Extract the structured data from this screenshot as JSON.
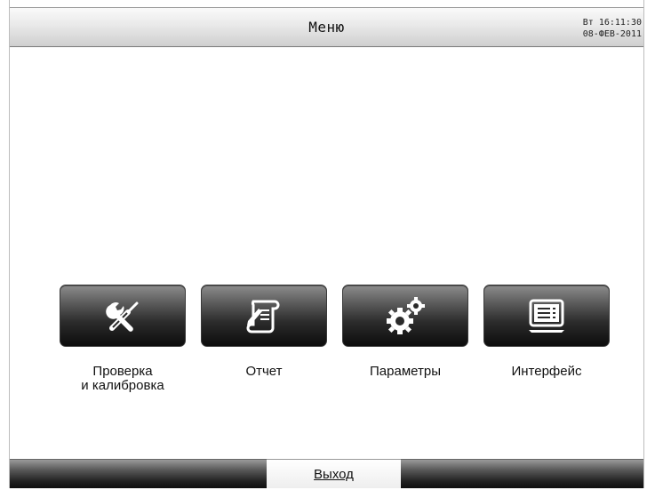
{
  "header": {
    "title": "Меню",
    "clock_time": "Вт 16:11:30",
    "clock_date": "08-ФЕВ-2011"
  },
  "menu": {
    "items": [
      {
        "label": "Проверка\nи калибровка",
        "icon": "tools-icon"
      },
      {
        "label": "Отчет",
        "icon": "report-scroll-icon"
      },
      {
        "label": "Параметры",
        "icon": "gears-icon"
      },
      {
        "label": "Интерфейс",
        "icon": "monitor-icon"
      }
    ]
  },
  "footer": {
    "exit_label": "Выход"
  }
}
